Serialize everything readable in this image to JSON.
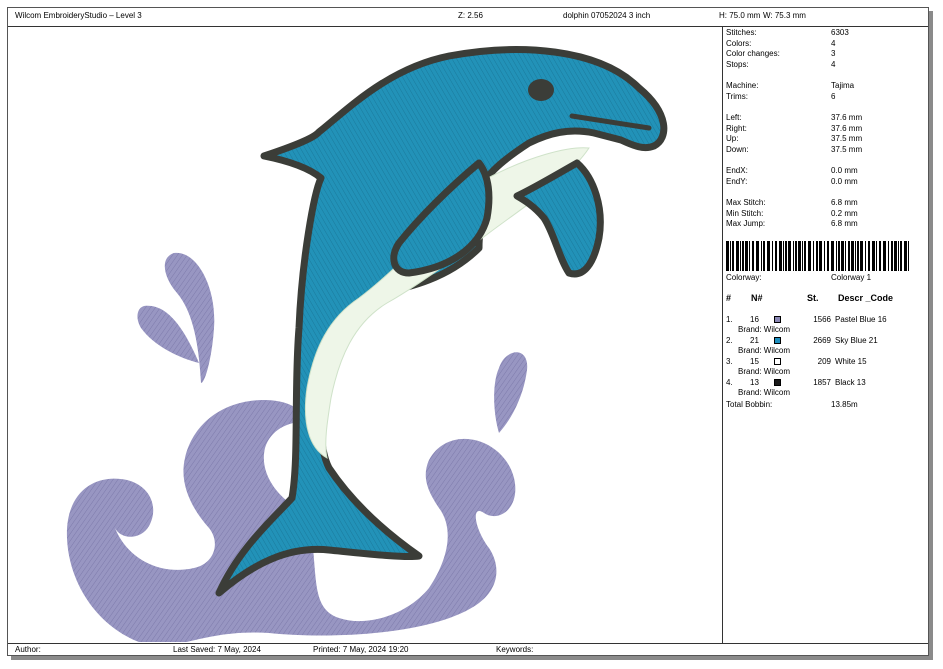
{
  "header": {
    "app_title": "Wilcom EmbroideryStudio – Level 3",
    "zoom": "Z: 2.56",
    "design_name": "dolphin 07052024 3 inch",
    "height": "H: 75.0 mm",
    "width": "W: 75.3 mm"
  },
  "stats": {
    "stitches_label": "Stitches:",
    "stitches": "6303",
    "colors_label": "Colors:",
    "colors": "4",
    "color_changes_label": "Color changes:",
    "color_changes": "3",
    "stops_label": "Stops:",
    "stops": "4",
    "machine_label": "Machine:",
    "machine": "Tajima",
    "trims_label": "Trims:",
    "trims": "6",
    "left_label": "Left:",
    "left": "37.6 mm",
    "right_label": "Right:",
    "right": "37.6 mm",
    "up_label": "Up:",
    "up": "37.5 mm",
    "down_label": "Down:",
    "down": "37.5 mm",
    "endx_label": "EndX:",
    "endx": "0.0 mm",
    "endy_label": "EndY:",
    "endy": "0.0 mm",
    "max_stitch_label": "Max Stitch:",
    "max_stitch": "6.8 mm",
    "min_stitch_label": "Min Stitch:",
    "min_stitch": "0.2 mm",
    "max_jump_label": "Max Jump:",
    "max_jump": "6.8 mm"
  },
  "colorway": {
    "label": "Colorway:",
    "value": "Colorway 1"
  },
  "thread_headers": {
    "num": "#",
    "n": "N#",
    "st": "St.",
    "desc": "Descr _Code"
  },
  "threads": [
    {
      "idx": "1.",
      "n": "16",
      "st": "1566",
      "desc": "Pastel Blue 16",
      "brand": "Brand: Wilcom",
      "color": "#8a87b4"
    },
    {
      "idx": "2.",
      "n": "21",
      "st": "2669",
      "desc": "Sky Blue 21",
      "brand": "Brand: Wilcom",
      "color": "#1e8fbf"
    },
    {
      "idx": "3.",
      "n": "15",
      "st": "209",
      "desc": "White 15",
      "brand": "Brand: Wilcom",
      "color": "#ffffff"
    },
    {
      "idx": "4.",
      "n": "13",
      "st": "1857",
      "desc": "Black 13",
      "brand": "Brand: Wilcom",
      "color": "#1a1a1a"
    }
  ],
  "bobbin": {
    "label": "Total Bobbin:",
    "value": "13.85m"
  },
  "footer": {
    "author_label": "Author:",
    "last_saved": "Last Saved:  7 May, 2024",
    "printed": "Printed:  7 May, 2024 19:20",
    "keywords_label": "Keywords:"
  },
  "colors": {
    "wave": "#9896c2",
    "dolphin": "#2292b8",
    "belly": "#eef6e8",
    "outline": "#3b3d38"
  }
}
